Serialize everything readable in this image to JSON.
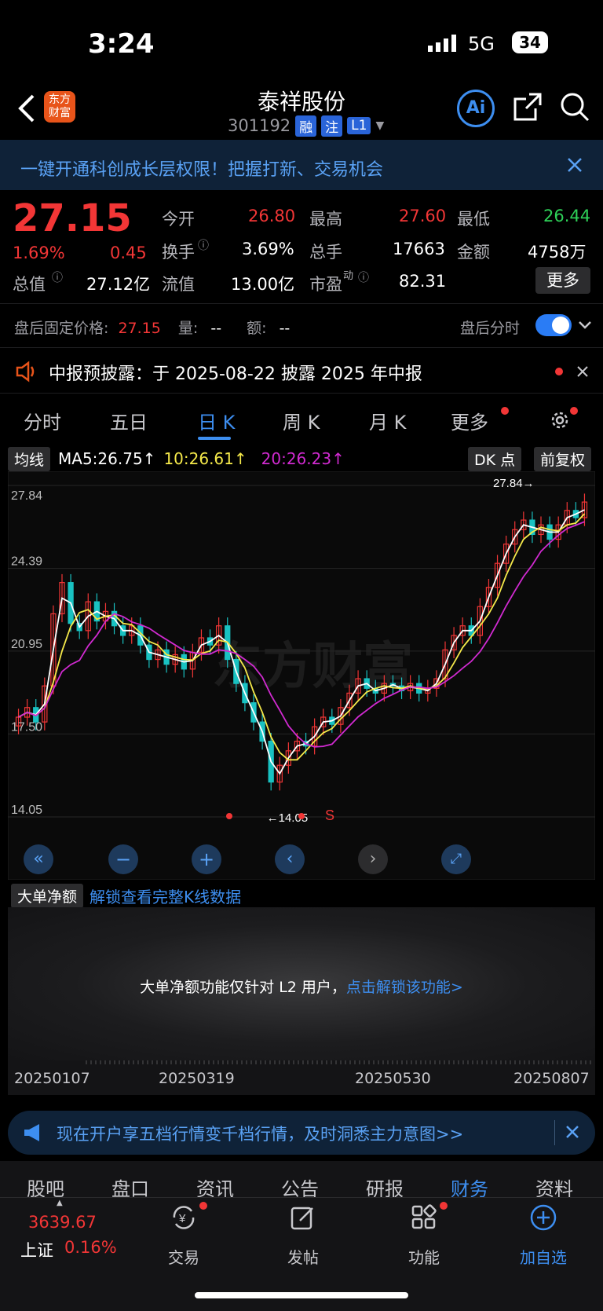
{
  "status": {
    "time": "3:24",
    "network": "5G",
    "battery": "34"
  },
  "header": {
    "title": "泰祥股份",
    "code": "301192",
    "tags": [
      "融",
      "注",
      "L1"
    ],
    "logo": "东方财富"
  },
  "banner": {
    "text": "一键开通科创成长层权限！把握打新、交易机会"
  },
  "quote": {
    "price": "27.15",
    "change_pct": "1.69%",
    "change": "0.45",
    "open_label": "今开",
    "open": "26.80",
    "high_label": "最高",
    "high": "27.60",
    "low_label": "最低",
    "low": "26.44",
    "turnover_label": "换手",
    "turnover": "3.69%",
    "volume_label": "总手",
    "volume": "17663",
    "amount_label": "金额",
    "amount": "4758万",
    "mcap_label": "总值",
    "mcap": "27.12亿",
    "float_label": "流值",
    "float": "13.00亿",
    "pe_label": "市盈",
    "pe_sup": "动",
    "pe": "82.31",
    "more": "更多"
  },
  "after_hours": {
    "label": "盘后固定价格:",
    "price": "27.15",
    "vol_label": "量:",
    "vol": "--",
    "amt_label": "额:",
    "amt": "--",
    "toggle_label": "盘后分时"
  },
  "notice": {
    "text": "中报预披露：于 2025-08-22 披露 2025 年中报"
  },
  "tabs": [
    "分时",
    "五日",
    "日 K",
    "周 K",
    "月 K",
    "更多"
  ],
  "ma": {
    "label": "均线",
    "ma5": "MA5:26.75↑",
    "ma10": "10:26.61↑",
    "ma20": "20:26.23↑",
    "dk": "DK 点",
    "fq": "前复权"
  },
  "chart_data": {
    "type": "candlestick",
    "y_ticks": [
      "27.84",
      "24.39",
      "20.95",
      "17.50",
      "14.05"
    ],
    "ylim": [
      14.05,
      27.84
    ],
    "max_label": "27.84→",
    "min_label": "←14.05",
    "signal": "S",
    "close_series": [
      18.2,
      18.6,
      18.0,
      19.5,
      22.5,
      23.8,
      22.1,
      21.8,
      23.0,
      22.2,
      22.6,
      22.0,
      21.6,
      22.0,
      21.2,
      20.6,
      21.0,
      20.4,
      20.8,
      20.2,
      20.9,
      21.5,
      21.2,
      22.0,
      20.6,
      19.6,
      18.8,
      18.0,
      17.2,
      15.5,
      16.2,
      16.8,
      17.2,
      17.0,
      17.8,
      18.2,
      17.9,
      18.6,
      19.2,
      19.8,
      19.4,
      19.2,
      19.6,
      19.5,
      19.3,
      19.6,
      19.2,
      19.4,
      19.8,
      21.0,
      21.6,
      22.0,
      21.6,
      22.8,
      23.6,
      24.6,
      25.4,
      26.0,
      26.4,
      25.8,
      26.2,
      25.6,
      26.2,
      26.8,
      26.5,
      27.15
    ],
    "ma_colors": {
      "ma5": "#ffffff",
      "ma10": "#f5e94a",
      "ma20": "#d12ad1"
    }
  },
  "indicator": {
    "label": "大单净额",
    "link": "解锁查看完整K线数据",
    "l2_text": "大单净额功能仅针对 L2 用户，",
    "l2_link": "点击解锁该功能>"
  },
  "dates": [
    "20250107",
    "20250319",
    "20250530",
    "20250807"
  ],
  "promo": {
    "text": "现在开户享五档行情变千档行情，及时洞悉主力意图>>"
  },
  "bottom_tabs": [
    "股吧",
    "盘口",
    "资讯",
    "公告",
    "研报",
    "财务",
    "资料"
  ],
  "index": {
    "value": "3639.67",
    "name": "上证",
    "pct": "0.16%"
  },
  "dock": [
    "交易",
    "发帖",
    "功能",
    "加自选"
  ],
  "colors": {
    "up": "#f23636",
    "down": "#2ed158",
    "accent": "#3d8ef0"
  }
}
